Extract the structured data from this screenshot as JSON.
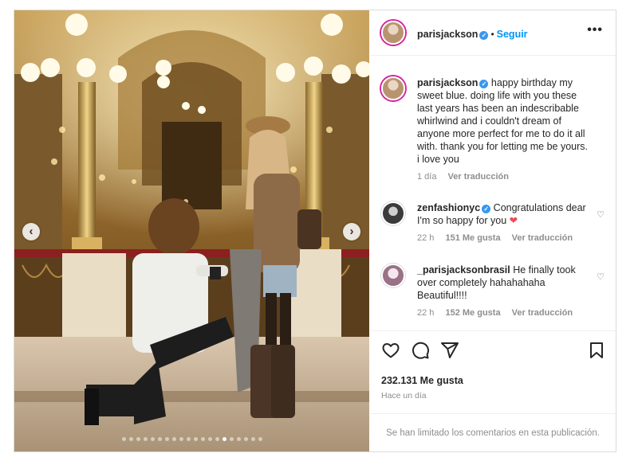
{
  "post": {
    "username": "parisjackson",
    "follow_label": "Seguir",
    "more_icon": "•••",
    "nav_prev": "‹",
    "nav_next": "›",
    "carousel_total": 20,
    "carousel_active": 14
  },
  "caption": {
    "username": "parisjackson",
    "text": "happy birthday my sweet blue. doing life with you these last years has been an indescribable whirlwind and i couldn't dream of anyone more perfect for me to do it all with. thank you for letting me be yours. i love you",
    "time": "1 día",
    "translate": "Ver traducción"
  },
  "comments": [
    {
      "username": "zenfashionyc",
      "text": "Congratulations dear I'm so happy for you",
      "emoji": "❤",
      "time": "22 h",
      "likes": "151 Me gusta",
      "translate": "Ver traducción"
    },
    {
      "username": "_parisjacksonbrasil",
      "text": "He finally took over completely hahahahaha Beautiful!!!!",
      "time": "22 h",
      "likes": "152 Me gusta",
      "translate": "Ver traducción"
    }
  ],
  "footer": {
    "likes": "232.131 Me gusta",
    "time_ago": "Hace un día",
    "comments_limited": "Se han limitado los comentarios en esta publicación."
  },
  "colors": {
    "accent": "#0095f6",
    "verified": "#3897f0",
    "heart": "#ed4956",
    "muted": "#8e8e8e"
  }
}
